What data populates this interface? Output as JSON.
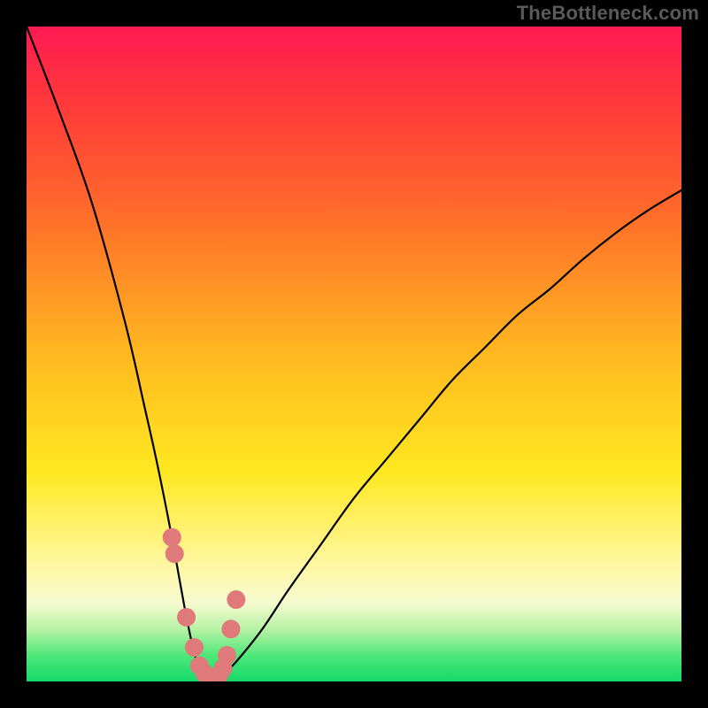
{
  "watermark": {
    "text": "TheBottleneck.com"
  },
  "chart_data": {
    "type": "line",
    "title": "",
    "xlabel": "",
    "ylabel": "",
    "xlim": [
      0,
      100
    ],
    "ylim": [
      0,
      100
    ],
    "series": [
      {
        "name": "bottleneck-profile",
        "x": [
          0,
          5,
          10,
          15,
          18,
          20,
          22,
          24,
          25,
          26,
          27,
          28,
          29,
          30,
          32,
          36,
          40,
          45,
          50,
          55,
          60,
          65,
          70,
          75,
          80,
          85,
          90,
          95,
          100
        ],
        "values": [
          100,
          87,
          73,
          55,
          42,
          33,
          23,
          12,
          7,
          3,
          1,
          0,
          0,
          1,
          3,
          8,
          14,
          21,
          28,
          34,
          40,
          46,
          51,
          56,
          60,
          64.5,
          68.5,
          72,
          75
        ]
      }
    ],
    "markers": {
      "name": "highlighted-points",
      "color": "#e07a7a",
      "x": [
        22.2,
        22.6,
        24.4,
        25.6,
        26.4,
        27.2,
        28.0,
        28.8,
        29.4,
        30.0,
        30.6,
        31.2,
        32.0
      ],
      "values": [
        22.0,
        19.5,
        9.8,
        5.2,
        2.4,
        1.2,
        0.6,
        0.6,
        1.0,
        2.0,
        4.0,
        8.0,
        12.5
      ]
    },
    "gradient_stops": [
      {
        "pos": 0.0,
        "color": "#ff1a52"
      },
      {
        "pos": 0.12,
        "color": "#ff3a3a"
      },
      {
        "pos": 0.28,
        "color": "#ff6a2a"
      },
      {
        "pos": 0.5,
        "color": "#ffb820"
      },
      {
        "pos": 0.68,
        "color": "#ffe820"
      },
      {
        "pos": 0.82,
        "color": "#fff7a0"
      },
      {
        "pos": 0.88,
        "color": "#f5fbd0"
      },
      {
        "pos": 0.92,
        "color": "#b7f2a5"
      },
      {
        "pos": 0.96,
        "color": "#4fe87a"
      },
      {
        "pos": 1.0,
        "color": "#14d96a"
      }
    ]
  }
}
